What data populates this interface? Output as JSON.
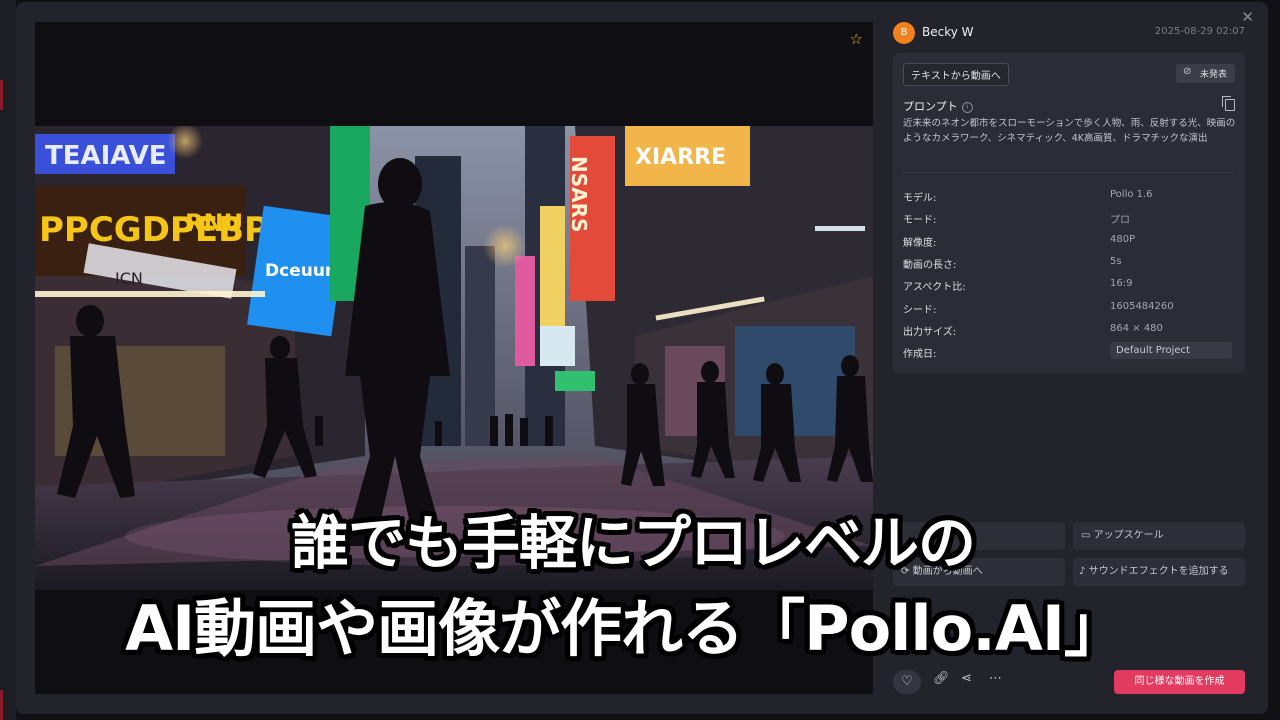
{
  "user": {
    "avatar_initial": "B",
    "name": "Becky W",
    "date": "2025-08-29 02:07"
  },
  "card": {
    "mode_tag": "テキストから動画へ",
    "visibility": "未発表",
    "prompt_title": "プロンプト",
    "prompt_text": "近未来のネオン都市をスローモーションで歩く人物、雨、反射する光、映画のようなカメラワーク、シネマティック、4K高画質、ドラマチックな演出",
    "meta": [
      {
        "key": "モデル:",
        "value": "Pollo 1.6"
      },
      {
        "key": "モード:",
        "value": "プロ"
      },
      {
        "key": "解像度:",
        "value": "480P"
      },
      {
        "key": "動画の長さ:",
        "value": "5s"
      },
      {
        "key": "アスペクト比:",
        "value": "16:9"
      },
      {
        "key": "シード:",
        "value": "1605484260"
      },
      {
        "key": "出力サイズ:",
        "value": "864 × 480"
      },
      {
        "key": "作成日:",
        "value": "Default Project"
      }
    ]
  },
  "actions": {
    "upscale": "アップスケール",
    "video_to_video": "動画から動画へ",
    "add_sound": "サウンドエフェクトを追加する",
    "canvas_edit": "Canvasで編集"
  },
  "bottom": {
    "create_similar": "同じ様な動画を作成"
  },
  "caption": {
    "line1": "誰でも手軽にプロレベルの",
    "line2": "AI動画や画像が作れる「Pollo.AI」"
  },
  "video_signs": [
    "NSARS",
    "XIARRE",
    "PPCGDPEBPV",
    "RNU",
    "TEAIAVE",
    "Dceuuri",
    "ICN"
  ],
  "colors": {
    "accent": "#e33a5f",
    "avatar": "#f2811d",
    "favorite": "#f0b429",
    "panel": "#2c2c36"
  }
}
